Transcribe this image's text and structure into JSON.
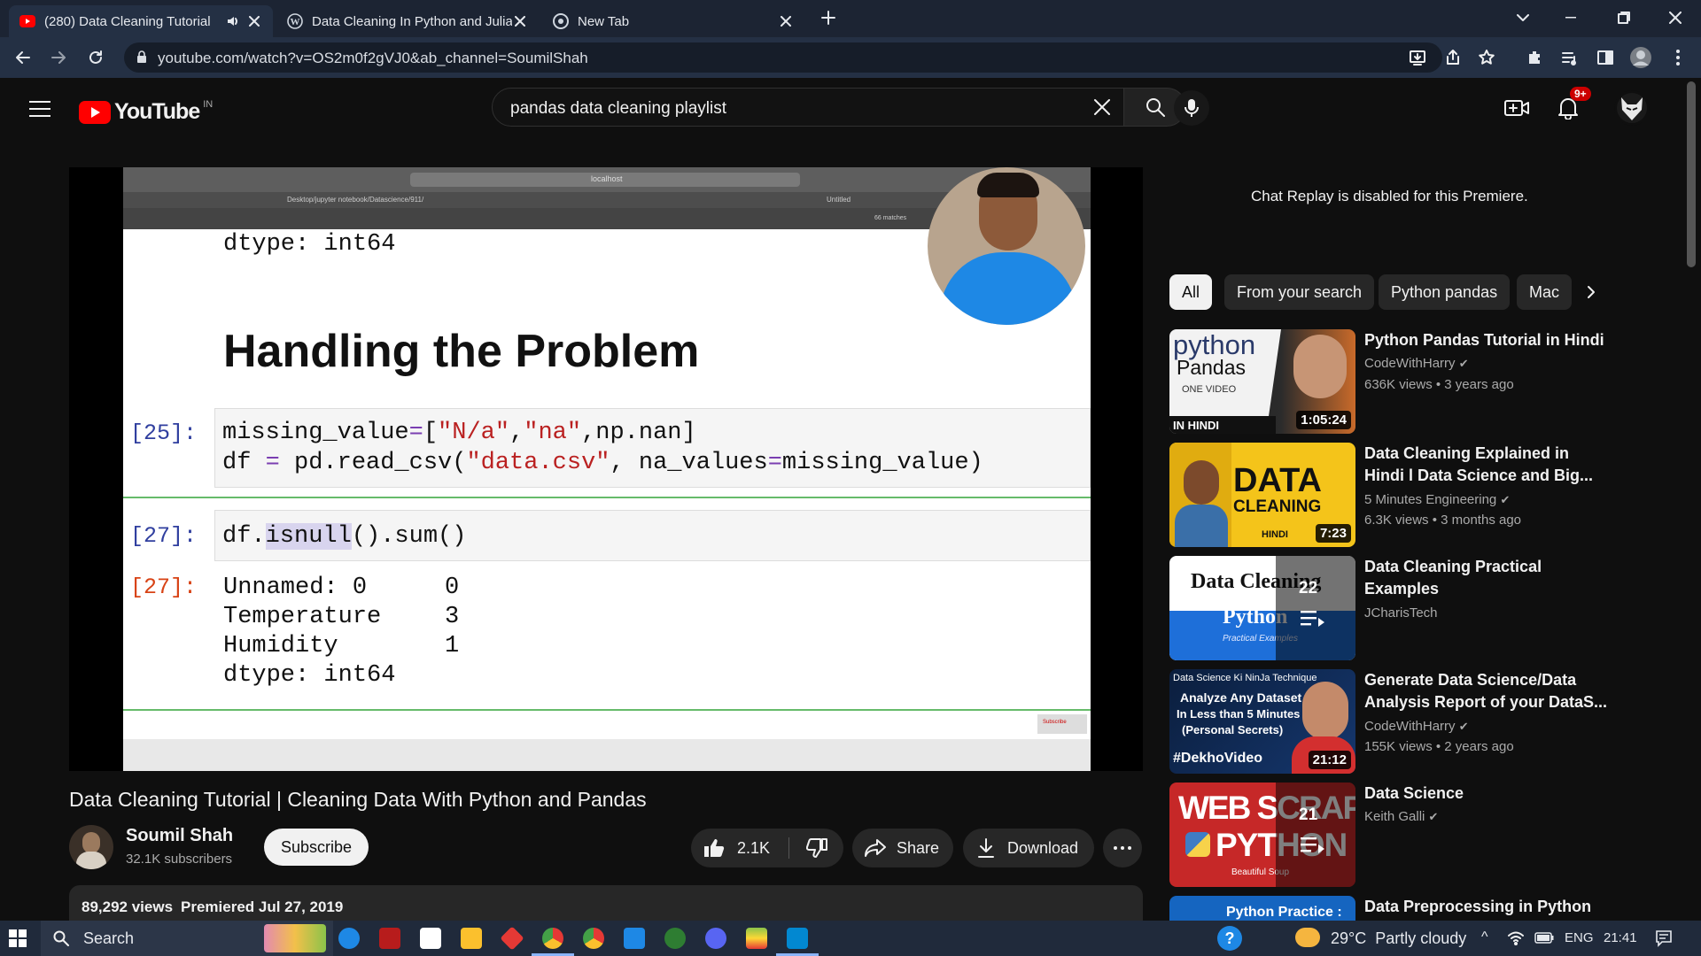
{
  "browser": {
    "tabs": [
      {
        "title": "(280) Data Cleaning Tutorial"
      },
      {
        "title": "Data Cleaning In Python and Julia"
      },
      {
        "title": "New Tab"
      }
    ],
    "url": "youtube.com/watch?v=OS2m0f2gVJ0&ab_channel=SoumilShah"
  },
  "youtube": {
    "logo_text": "YouTube",
    "region": "IN",
    "search_query": "pandas data cleaning playlist",
    "notification_count": "9+"
  },
  "video": {
    "slide": {
      "mac_url": "localhost",
      "path_tab": "Desktop/jupyter notebook/Datascience/911/",
      "untitled_tab": "Untitled",
      "matches": "66 matches",
      "dtype_top": "dtype: int64",
      "heading": "Handling the Problem",
      "cell25_prompt": "[25]:",
      "cell27_prompt": "[27]:",
      "out27_prompt": "[27]:",
      "out_rows": [
        {
          "name": "Unnamed: 0",
          "value": "0"
        },
        {
          "name": "Temperature",
          "value": "3"
        },
        {
          "name": "Humidity",
          "value": "1"
        }
      ],
      "dtype_bottom": "dtype: int64",
      "subscribe_overlay": "Subscribe"
    },
    "title": "Data Cleaning Tutorial | Cleaning Data With Python and Pandas",
    "channel": "Soumil Shah",
    "subscribers": "32.1K subscribers",
    "subscribe_label": "Subscribe",
    "likes": "2.1K",
    "share_label": "Share",
    "download_label": "Download",
    "views": "89,292 views",
    "premiered": "Premiered Jul 27, 2019"
  },
  "chat": {
    "message": "Chat Replay is disabled for this Premiere."
  },
  "chips": [
    "All",
    "From your search",
    "Python pandas",
    "Mac"
  ],
  "recommendations": [
    {
      "title_l1": "Python Pandas Tutorial in Hindi",
      "title_l2": "",
      "channel": "CodeWithHarry",
      "meta": "636K views • 3 years ago",
      "duration": "1:05:24",
      "thumb_lines": [
        "python",
        "Pandas",
        "ONE VIDEO",
        "IN HINDI"
      ]
    },
    {
      "title_l1": "Data Cleaning Explained in",
      "title_l2": "Hindi l Data Science and Big...",
      "channel": "5 Minutes Engineering",
      "meta": "6.3K views • 3 months ago",
      "duration": "7:23",
      "thumb_lines": [
        "DATA",
        "CLEANING",
        "HINDI"
      ]
    },
    {
      "title_l1": "Data Cleaning Practical",
      "title_l2": "Examples",
      "channel": "JCharisTech",
      "meta": "",
      "duration": "22",
      "thumb_lines": [
        "Data Cleaning",
        "Python",
        "Practical Examples"
      ]
    },
    {
      "title_l1": "Generate Data Science/Data",
      "title_l2": "Analysis Report of your DataS...",
      "channel": "CodeWithHarry",
      "meta": "155K views • 2 years ago",
      "duration": "21:12",
      "thumb_lines": [
        "Data Science Ki NinJa Technique",
        "Analyze Any Dataset",
        "In Less than 5 Minutes",
        "(Personal Secrets)",
        "#DekhoVideo"
      ]
    },
    {
      "title_l1": "Data Science",
      "title_l2": "",
      "channel": "Keith Galli",
      "meta": "",
      "duration": "21",
      "thumb_lines": [
        "WEB SCRAPING",
        "PYTHON",
        "Beautiful Soup"
      ]
    },
    {
      "title_l1": "Data Preprocessing in Python",
      "title_l2": "",
      "channel": "",
      "meta": "",
      "duration": "",
      "thumb_lines": [
        "Python Practice :"
      ]
    }
  ],
  "taskbar": {
    "search_label": "Search",
    "weather": "29°C  Partly cloudy",
    "language": "ENG",
    "time": "21:41"
  }
}
